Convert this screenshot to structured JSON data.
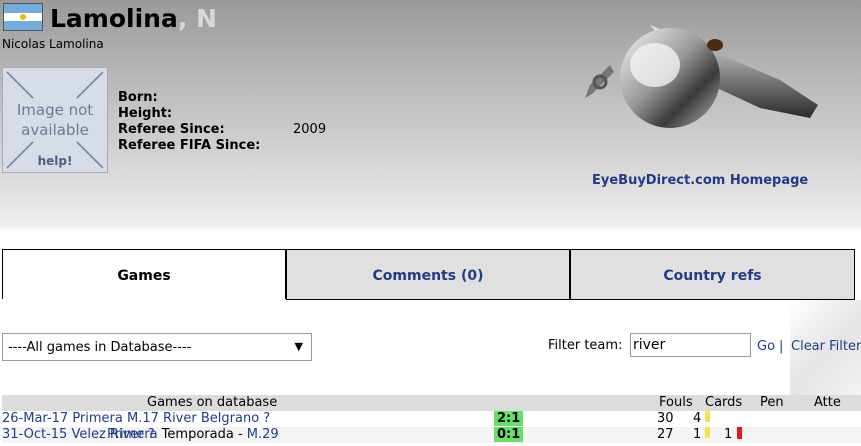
{
  "referee": {
    "last_name": "Lamolina",
    "initial": ", N",
    "full_name": "Nicolas Lamolina",
    "flag_icon": "argentina-flag-icon"
  },
  "placeholder_image": {
    "line1": "Image not",
    "line2": "available",
    "line3": "help!"
  },
  "info": {
    "born_label": "Born:",
    "height_label": "Height:",
    "since_label": "Referee Since:",
    "since_value": "2009",
    "fifa_label": "Referee FIFA Since:"
  },
  "ad": {
    "link": "EyeBuyDirect.com Homepage"
  },
  "tabs": [
    {
      "label": "Games",
      "active": true
    },
    {
      "label": "Comments (0)",
      "active": false
    },
    {
      "label": "Country refs",
      "active": false
    }
  ],
  "filter": {
    "select_value": "----All games in Database----",
    "label": "Filter team:",
    "input_value": "river",
    "go": "Go",
    "separator": "|",
    "clear": "Clear Filter"
  },
  "table": {
    "headers": {
      "games": "Games on database",
      "fouls": "Fouls",
      "cards": "Cards",
      "pen": "Pen",
      "att": "Atte"
    },
    "rows": [
      {
        "date": "26-Mar-17",
        "comp": "Primera M.17",
        "home": "River",
        "score": "2:1",
        "away": "Belgrano",
        "fouls": "30",
        "yellow": "4",
        "red": "",
        "att": "?"
      },
      {
        "date": "31-Oct-15",
        "comp_link": "Primera",
        "comp_text": " Temporada - ",
        "comp_round": "M.29",
        "home": "Velez",
        "score": "0:1",
        "away": "River",
        "fouls": "27",
        "yellow": "1",
        "red": "1",
        "att": "?"
      }
    ]
  },
  "colors": {
    "link": "#1f3c88",
    "score_bg": "#66e066",
    "yellow_card": "#f0e64a",
    "red_card": "#e01a1a"
  }
}
